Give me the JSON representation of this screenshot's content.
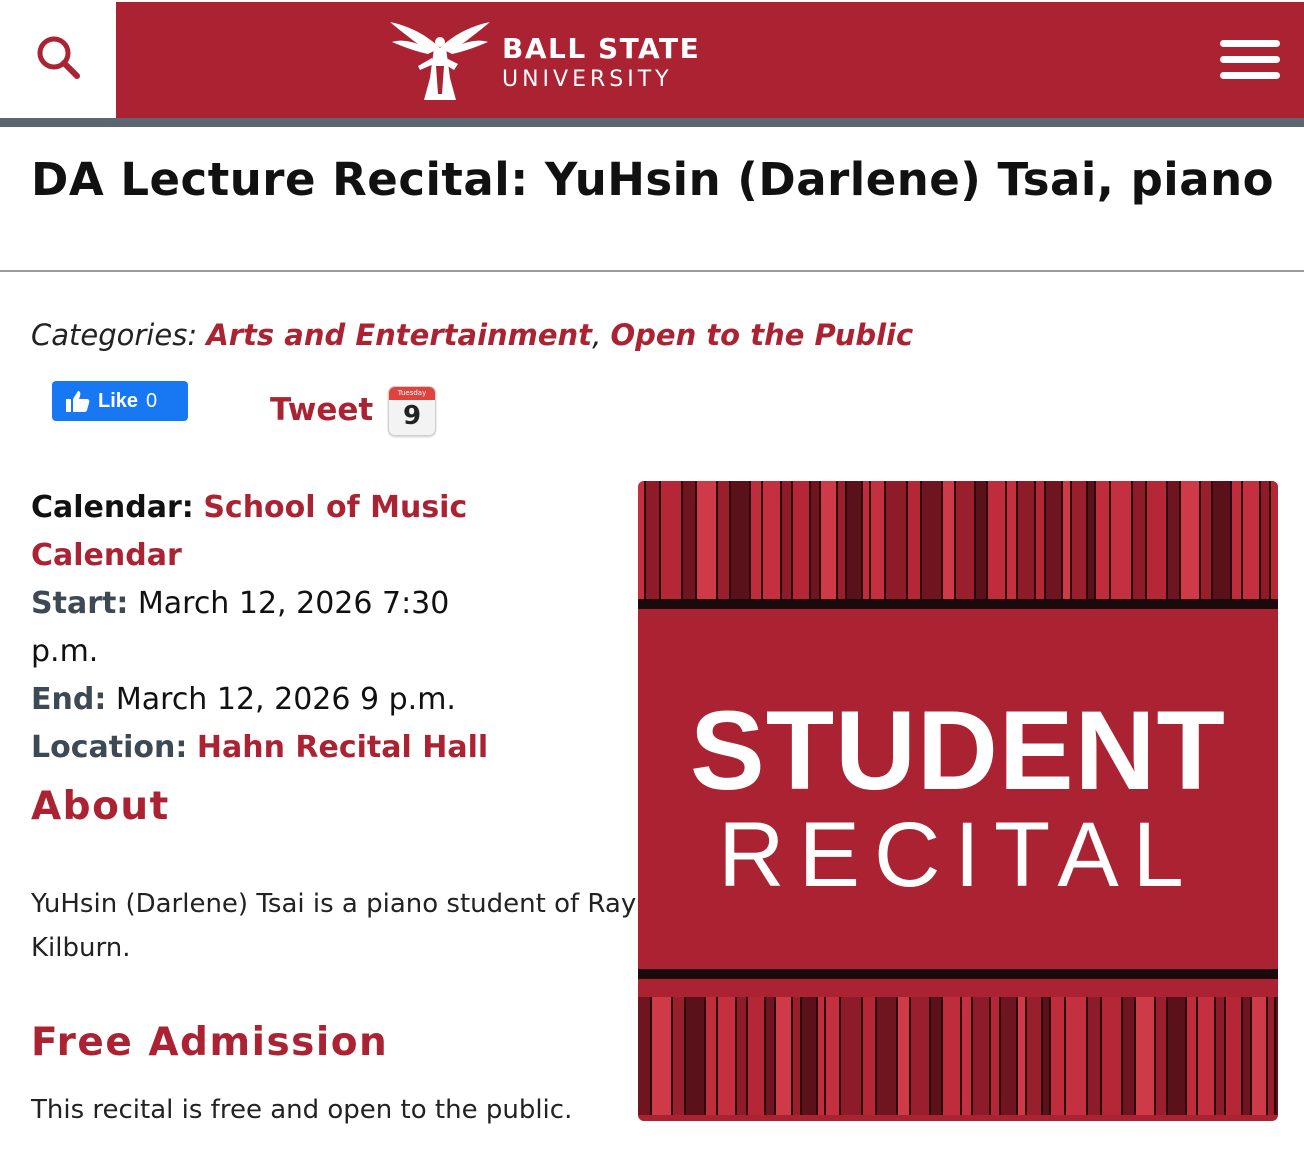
{
  "header": {
    "logo_line1": "BALL STATE",
    "logo_line2": "UNIVERSITY",
    "search_icon": "search-icon",
    "menu_icon": "hamburger-menu-icon",
    "brand_color": "#ab2332"
  },
  "event": {
    "title": "DA Lecture Recital: YuHsin (Darlene) Tsai, piano",
    "categories_label": "Categories:",
    "categories": [
      "Arts and Entertainment",
      "Open to the Public"
    ],
    "categories_sep": ",",
    "social": {
      "like_label": "Like",
      "like_count": "0",
      "tweet_label": "Tweet",
      "calendar_day": "9",
      "calendar_month": "Tuesday"
    },
    "details": {
      "calendar_label": "Calendar:",
      "calendar_value": "School of Music Calendar",
      "start_label": "Start:",
      "start_value": "March 12, 2026 7:30 p.m.",
      "end_label": "End:",
      "end_value": "March 12, 2026 9 p.m.",
      "location_label": "Location:",
      "location_value": "Hahn Recital Hall"
    },
    "about_heading": "About",
    "about_text": "YuHsin (Darlene) Tsai is a piano student of Ray Kilburn.",
    "admission_heading": "Free Admission",
    "admission_text": "This recital is free and open to the public.",
    "image_line1": "STUDENT",
    "image_line2": "RECITAL"
  }
}
